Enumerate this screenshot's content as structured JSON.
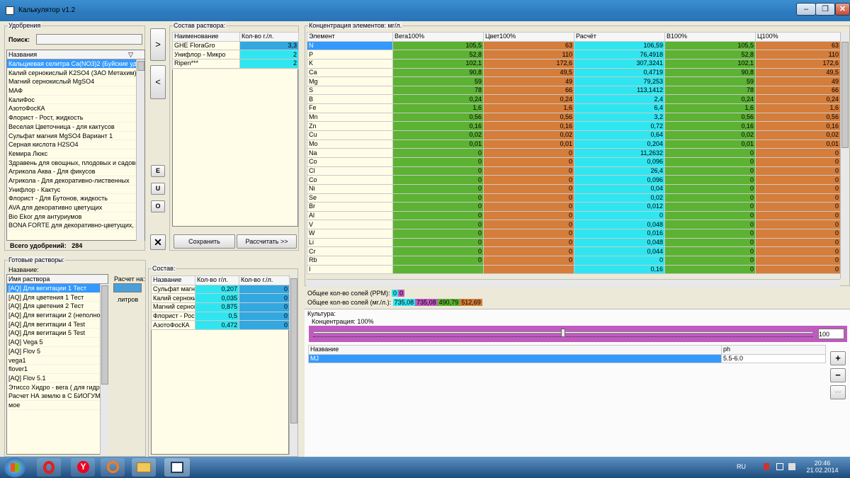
{
  "window": {
    "title": "Калькулятор v1.2",
    "minimize": "‒",
    "maximize": "❐",
    "close": "✕"
  },
  "fertilizers": {
    "group_label": "Удобрения",
    "search_label": "Поиск:",
    "search_value": "",
    "col_name": "Названия",
    "items": [
      "Кальциевая селитра Ca(NO3)2 (Буйские уд-я)",
      "Калий сернокислый K2SO4 (ЗАО Метахим)",
      "Магний сернокислый MgSO4",
      "МАФ",
      "КалиФос",
      "АзотоФосКА",
      "Флорист - Рост, жидкость",
      "Веселая Цветочница - для кактусов",
      "Сульфат магния MgSO4 Вариант 1",
      "Серная кислота H2SO4",
      "Кемира Люкс",
      "Здравень для овощных, плодовых и садовых к",
      "Агрикола Аква - Для фикусов",
      "Агрикола - Для декоративно-лиственных",
      "Унифлор - Кактус",
      "Флорист - Для Бутонов, жидкость",
      "AVA для декоративно цветущих",
      "Bio Ekor для антуриумов",
      "BONA FORTE для декоративно-цветущих, жид"
    ],
    "total_label": "Всего удобрений:",
    "total_value": "284"
  },
  "middle_buttons": {
    "add": ">",
    "remove": "<",
    "e": "E",
    "u": "U",
    "o": "O",
    "delete": "✕"
  },
  "solution": {
    "group_label": "Состав раствора:",
    "col_name": "Наименование",
    "col_qty": "Кол-во г./л.",
    "rows": [
      {
        "name": "GHE FloraGro",
        "qty": "3,3"
      },
      {
        "name": "Унифлор - Микро",
        "qty": "2"
      },
      {
        "name": "Ripen***",
        "qty": "2"
      }
    ],
    "save": "Сохранить",
    "calc": "Рассчитать >>"
  },
  "ready": {
    "group_label": "Готовые растворы:",
    "name_label": "Название:",
    "col_name": "Имя раствора",
    "items": [
      "[AQ] Для вегитации 1 Тест",
      "[AQ] Для цветения 1 Тест",
      "[AQ] Для цветения 2 Тест",
      "[AQ] Для вегитации 2 (неполноце",
      "[AQ] Для вегитации 4 Test",
      "[AQ] Для вегитации 5 Test",
      "[AQ] Vega 5",
      "[AQ] Flov 5",
      "vega1",
      "flover1",
      "[AQ] Flov 5.1",
      "Этиссо Хидро - вега ( для гидры)",
      "Расчет НА землю в С БИОГУМА(",
      "мое"
    ],
    "calc_label": "Расчет на:",
    "calc_value": "",
    "liters": "литров"
  },
  "composition": {
    "group_label": "Состав:",
    "col_name": "Название",
    "col_qty1": "Кол-во г/л.",
    "col_qty2": "Кол-во г./л.",
    "rows": [
      {
        "name": "Сульфат магни",
        "q1": "0,207",
        "q2": "0"
      },
      {
        "name": "Калий  серноки",
        "q1": "0,035",
        "q2": "0"
      },
      {
        "name": "Магний сернок",
        "q1": "0,875",
        "q2": "0"
      },
      {
        "name": "Флорист - Рост",
        "q1": "0,5",
        "q2": "0"
      },
      {
        "name": "АзотоФосКА",
        "q1": "0,472",
        "q2": "0"
      }
    ]
  },
  "concentration": {
    "group_label": "Концентрация элементов: мг/л.",
    "headers": [
      "Элемент",
      "Вега100%",
      "Цвет100%",
      "Расчёт",
      "В100%",
      "Ц100%"
    ],
    "rows": [
      [
        "N",
        "105,5",
        "63",
        "106,59",
        "105,5",
        "63"
      ],
      [
        "P",
        "52,8",
        "110",
        "76,4918",
        "52,8",
        "110"
      ],
      [
        "K",
        "102,1",
        "172,6",
        "307,3241",
        "102,1",
        "172,6"
      ],
      [
        "Ca",
        "90,8",
        "49,5",
        "0,4719",
        "90,8",
        "49,5"
      ],
      [
        "Mg",
        "59",
        "49",
        "79,253",
        "59",
        "49"
      ],
      [
        "S",
        "78",
        "66",
        "113,1412",
        "78",
        "66"
      ],
      [
        "B",
        "0,24",
        "0,24",
        "2,4",
        "0,24",
        "0,24"
      ],
      [
        "Fe",
        "1,6",
        "1,6",
        "6,4",
        "1,6",
        "1,6"
      ],
      [
        "Mn",
        "0,56",
        "0,56",
        "3,2",
        "0,56",
        "0,56"
      ],
      [
        "Zn",
        "0,16",
        "0,16",
        "0,72",
        "0,16",
        "0,16"
      ],
      [
        "Cu",
        "0,02",
        "0,02",
        "0,64",
        "0,02",
        "0,02"
      ],
      [
        "Mo",
        "0,01",
        "0,01",
        "0,204",
        "0,01",
        "0,01"
      ],
      [
        "Na",
        "0",
        "0",
        "11,2632",
        "0",
        "0"
      ],
      [
        "Co",
        "0",
        "0",
        "0,096",
        "0",
        "0"
      ],
      [
        "Cl",
        "0",
        "0",
        "26,4",
        "0",
        "0"
      ],
      [
        "Co",
        "0",
        "0",
        "0,096",
        "0",
        "0"
      ],
      [
        "Ni",
        "0",
        "0",
        "0,04",
        "0",
        "0"
      ],
      [
        "Se",
        "0",
        "0",
        "0,02",
        "0",
        "0"
      ],
      [
        "Br",
        "0",
        "0",
        "0,012",
        "0",
        "0"
      ],
      [
        "Al",
        "0",
        "0",
        "0",
        "0",
        "0"
      ],
      [
        "V",
        "0",
        "0",
        "0,048",
        "0",
        "0"
      ],
      [
        "W",
        "0",
        "0",
        "0,016",
        "0",
        "0"
      ],
      [
        "Li",
        "0",
        "0",
        "0,048",
        "0",
        "0"
      ],
      [
        "Cr",
        "0",
        "0",
        "0,044",
        "0",
        "0"
      ],
      [
        "Rb",
        "0",
        "0",
        "0",
        "0",
        "0"
      ],
      [
        "I",
        "",
        "",
        "0,16",
        "0",
        "0"
      ]
    ],
    "ppm_label": "Общее кол-во солей (PPM):",
    "ppm_values": [
      "0",
      "0"
    ],
    "mg_label": "Общее кол-во солей (мг./л.):",
    "mg_values": [
      "735,08",
      "735,08",
      "490,79",
      "512,69"
    ]
  },
  "culture": {
    "group_label": "Культура:",
    "conc_label": "Концентрация: 100%",
    "slider_value": "100",
    "slider_level": 0.5,
    "col_name": "Название",
    "col_ph": "ph",
    "rows": [
      {
        "name": "MJ",
        "ph": "5.5-6.0"
      }
    ],
    "add": "+",
    "remove": "−",
    "edit": "〰"
  },
  "taskbar": {
    "lang": "RU",
    "time": "20:46",
    "date": "21.02.2014"
  },
  "colors": {
    "green": "#5cb233",
    "orange": "#d57d3a",
    "cyan": "#2fe6f0",
    "blue": "#33a8e0",
    "magenta": "#c05ac0",
    "selection": "#3399ff"
  }
}
